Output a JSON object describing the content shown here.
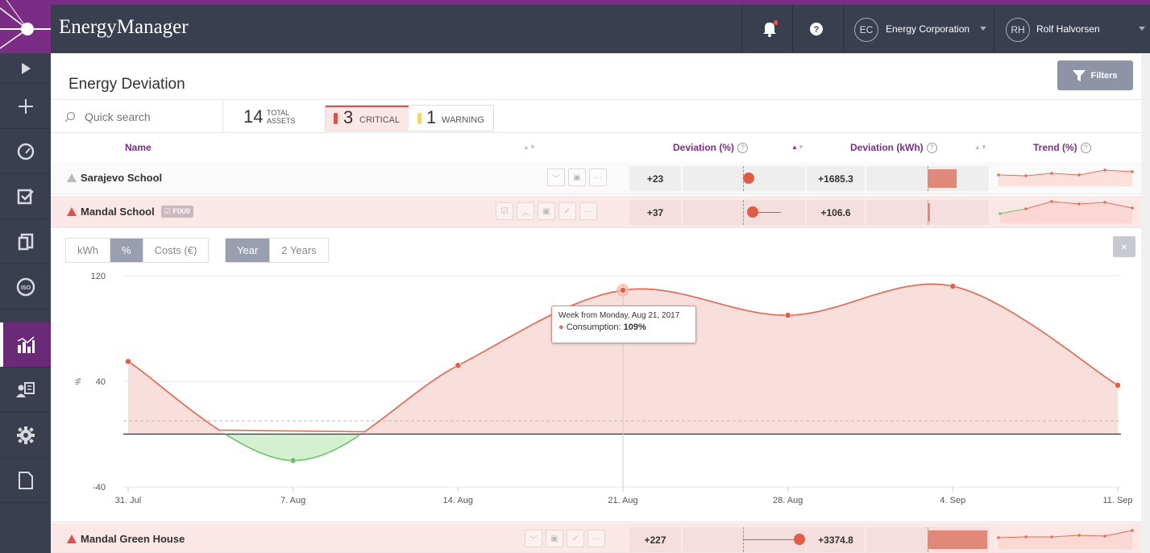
{
  "app": {
    "brand": "EnergyManager"
  },
  "topbar": {
    "org_initials": "EC",
    "org_name": "Energy Corporation",
    "user_initials": "RH",
    "user_name": "Rolf Halvorsen",
    "help_label": "?"
  },
  "page": {
    "title": "Energy Deviation",
    "filters_label": "Filters"
  },
  "search": {
    "placeholder": "Quick search"
  },
  "stats": {
    "total_num": "14",
    "total_label_1": "TOTAL",
    "total_label_2": "ASSETS",
    "critical_num": "3",
    "critical_label": "CRITICAL",
    "warning_num": "1",
    "warning_label": "WARNING"
  },
  "columns": {
    "name": "Name",
    "dev_pct": "Deviation (%)",
    "dev_kwh": "Deviation (kWh)",
    "trend": "Trend (%)"
  },
  "rows": [
    {
      "name": "Sarajevo School",
      "dev_pct": "+23",
      "dev_kwh": "+1685.3",
      "dot_pos": 0.1,
      "kwh_fill": 0.24,
      "severity": "warning"
    },
    {
      "name": "Mandal School",
      "badge": "FIX/0",
      "dev_pct": "+37",
      "dev_kwh": "+106.6",
      "dot_pos": 0.17,
      "kwh_fill": 0.02,
      "severity": "critical"
    },
    {
      "name": "Mandal Green House",
      "dev_pct": "+227",
      "dev_kwh": "+3374.8",
      "dot_pos": 1.0,
      "kwh_fill": 0.49,
      "severity": "critical"
    }
  ],
  "chart_controls": {
    "units": [
      "kWh",
      "%",
      "Costs (€)"
    ],
    "selected_unit": "%",
    "periods": [
      "Year",
      "2 Years"
    ],
    "selected_period": "Year",
    "close_label": "×"
  },
  "tooltip": {
    "line1": "Week from Monday, Aug 21, 2017",
    "label": "Consumption:",
    "value": "109%"
  },
  "colors": {
    "brand": "#7b2d86",
    "critical": "#d9534f",
    "warning": "#f5d36b",
    "positive_area": "#f9dfdc",
    "negative_area": "#d5f0d0",
    "line": "#e0705a",
    "green": "#6cc46a"
  },
  "chart_data": {
    "type": "area",
    "x": [
      "31. Jul",
      "7. Aug",
      "14. Aug",
      "21. Aug",
      "28. Aug",
      "4. Sep",
      "11. Sep"
    ],
    "series": [
      {
        "values": [
          55,
          -20,
          52,
          109,
          90,
          112,
          37
        ]
      }
    ],
    "ylabel": "%",
    "yticks": [
      120,
      40,
      -40
    ],
    "ylim": [
      -40,
      120
    ],
    "baseline": 0,
    "reference_line": 10,
    "highlight_index": 3
  }
}
